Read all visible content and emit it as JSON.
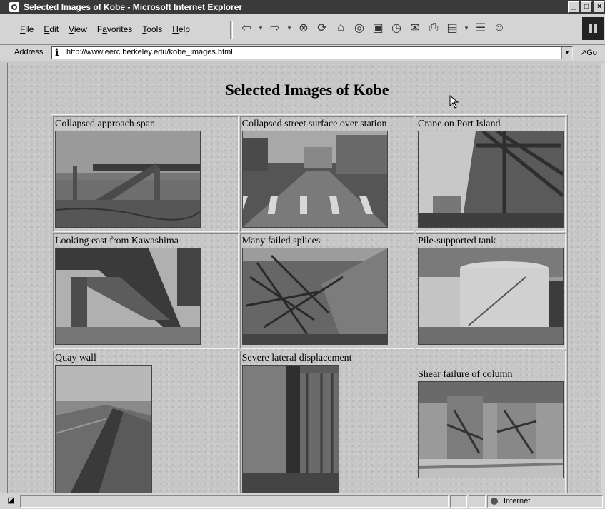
{
  "window": {
    "title": "Selected Images of Kobe - Microsoft Internet Explorer",
    "buttons": [
      "_",
      "□",
      "×"
    ]
  },
  "menu": {
    "items": [
      {
        "u": "F",
        "rest": "ile"
      },
      {
        "pre": "",
        "u": "E",
        "rest": "dit"
      },
      {
        "u": "V",
        "rest": "iew"
      },
      {
        "pre": "F",
        "u": "a",
        "rest": "vorites"
      },
      {
        "u": "T",
        "rest": "ools"
      },
      {
        "u": "H",
        "rest": "elp"
      }
    ]
  },
  "toolbar": {
    "icons": [
      "back-icon",
      "dropdown-arrow-icon",
      "forward-icon",
      "dropdown-arrow-icon",
      "stop-icon",
      "refresh-icon",
      "home-icon",
      "search-icon",
      "favorites-icon",
      "history-icon",
      "mail-icon",
      "print-icon",
      "edit-icon",
      "dropdown-arrow-icon",
      "discuss-icon",
      "messenger-icon"
    ]
  },
  "address": {
    "label": "Address",
    "url": "http://www.eerc.berkeley.edu/kobe_images.html",
    "go_label": "Go"
  },
  "page": {
    "title": "Selected Images of Kobe",
    "images": [
      {
        "caption": "Collapsed approach span"
      },
      {
        "caption": "Collapsed street surface over station"
      },
      {
        "caption": "Crane on Port Island"
      },
      {
        "caption": "Looking east from Kawashima"
      },
      {
        "caption": "Many failed splices"
      },
      {
        "caption": "Pile-supported tank"
      },
      {
        "caption": "Quay wall"
      },
      {
        "caption": "Severe lateral displacement"
      },
      {
        "caption": "Shear failure of column"
      }
    ]
  },
  "status": {
    "zone": "Internet"
  }
}
